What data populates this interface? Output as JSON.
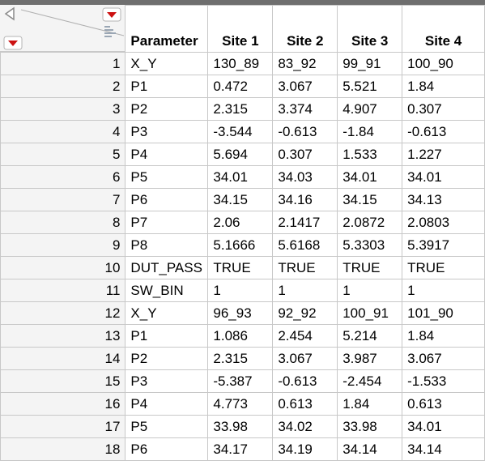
{
  "header": {
    "parameter_label": "Parameter",
    "sites": [
      "Site 1",
      "Site 2",
      "Site 3",
      "Site 4"
    ]
  },
  "icons": {
    "collapse": "collapse-left-arrow-icon",
    "table_menu": "red-triangle-menu-icon",
    "columns_menu": "red-triangle-menu-icon",
    "rows_menu": "red-triangle-menu-icon",
    "column_selector": "column-list-icon"
  },
  "colors": {
    "menu_triangle": "#cc1111",
    "grid_line": "#c8c8c8",
    "row_header_bg": "#f4f4f4"
  },
  "rows": [
    {
      "n": "1",
      "param": "X_Y",
      "v": [
        "130_89",
        "83_92",
        "99_91",
        "100_90"
      ]
    },
    {
      "n": "2",
      "param": "P1",
      "v": [
        "0.472",
        "3.067",
        "5.521",
        "1.84"
      ]
    },
    {
      "n": "3",
      "param": "P2",
      "v": [
        "2.315",
        "3.374",
        "4.907",
        "0.307"
      ]
    },
    {
      "n": "4",
      "param": "P3",
      "v": [
        "-3.544",
        "-0.613",
        "-1.84",
        "-0.613"
      ]
    },
    {
      "n": "5",
      "param": "P4",
      "v": [
        "5.694",
        "0.307",
        "1.533",
        "1.227"
      ]
    },
    {
      "n": "6",
      "param": "P5",
      "v": [
        "34.01",
        "34.03",
        "34.01",
        "34.01"
      ]
    },
    {
      "n": "7",
      "param": "P6",
      "v": [
        "34.15",
        "34.16",
        "34.15",
        "34.13"
      ]
    },
    {
      "n": "8",
      "param": "P7",
      "v": [
        "2.06",
        "2.1417",
        "2.0872",
        "2.0803"
      ]
    },
    {
      "n": "9",
      "param": "P8",
      "v": [
        "5.1666",
        "5.6168",
        "5.3303",
        "5.3917"
      ]
    },
    {
      "n": "10",
      "param": "DUT_PASS",
      "v": [
        "TRUE",
        "TRUE",
        "TRUE",
        "TRUE"
      ]
    },
    {
      "n": "11",
      "param": "SW_BIN",
      "v": [
        "1",
        "1",
        "1",
        "1"
      ]
    },
    {
      "n": "12",
      "param": "X_Y",
      "v": [
        "96_93",
        "92_92",
        "100_91",
        "101_90"
      ]
    },
    {
      "n": "13",
      "param": "P1",
      "v": [
        "1.086",
        "2.454",
        "5.214",
        "1.84"
      ]
    },
    {
      "n": "14",
      "param": "P2",
      "v": [
        "2.315",
        "3.067",
        "3.987",
        "3.067"
      ]
    },
    {
      "n": "15",
      "param": "P3",
      "v": [
        "-5.387",
        "-0.613",
        "-2.454",
        "-1.533"
      ]
    },
    {
      "n": "16",
      "param": "P4",
      "v": [
        "4.773",
        "0.613",
        "1.84",
        "0.613"
      ]
    },
    {
      "n": "17",
      "param": "P5",
      "v": [
        "33.98",
        "34.02",
        "33.98",
        "34.01"
      ]
    },
    {
      "n": "18",
      "param": "P6",
      "v": [
        "34.17",
        "34.19",
        "34.14",
        "34.14"
      ]
    }
  ]
}
